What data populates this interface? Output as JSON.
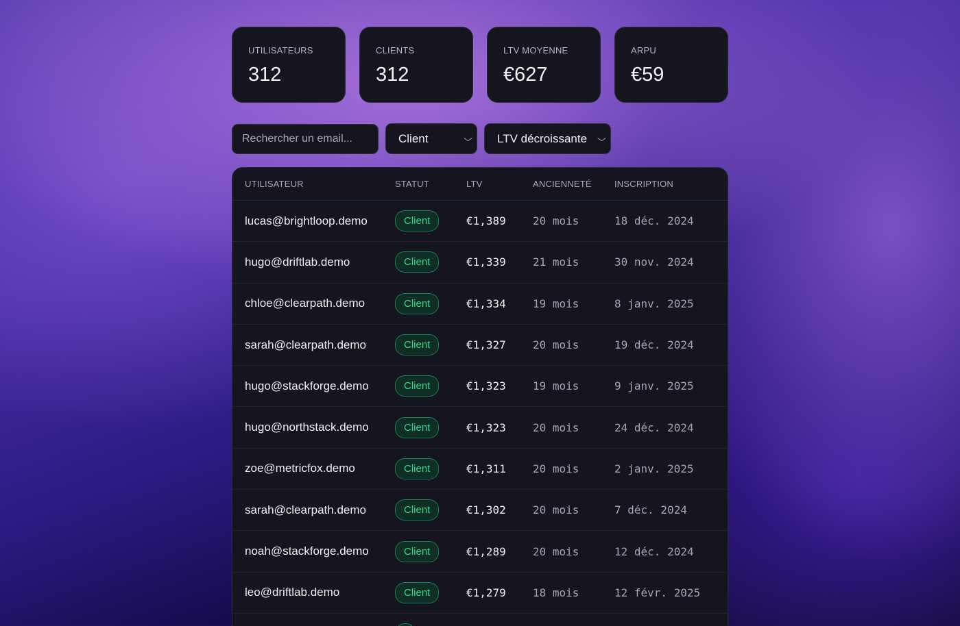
{
  "stats": [
    {
      "label": "UTILISATEURS",
      "value": "312"
    },
    {
      "label": "CLIENTS",
      "value": "312"
    },
    {
      "label": "LTV MOYENNE",
      "value": "€627"
    },
    {
      "label": "ARPU",
      "value": "€59"
    }
  ],
  "filters": {
    "search_placeholder": "Rechercher un email...",
    "status_selected": "Client",
    "sort_selected": "LTV décroissante"
  },
  "table": {
    "headers": {
      "user": "UTILISATEUR",
      "status": "STATUT",
      "ltv": "LTV",
      "age": "ANCIENNETÉ",
      "signup": "INSCRIPTION"
    },
    "rows": [
      {
        "email": "lucas@brightloop.demo",
        "status": "Client",
        "ltv": "€1,389",
        "age": "20 mois",
        "signup": "18 déc. 2024"
      },
      {
        "email": "hugo@driftlab.demo",
        "status": "Client",
        "ltv": "€1,339",
        "age": "21 mois",
        "signup": "30 nov. 2024"
      },
      {
        "email": "chloe@clearpath.demo",
        "status": "Client",
        "ltv": "€1,334",
        "age": "19 mois",
        "signup": "8 janv. 2025"
      },
      {
        "email": "sarah@clearpath.demo",
        "status": "Client",
        "ltv": "€1,327",
        "age": "20 mois",
        "signup": "19 déc. 2024"
      },
      {
        "email": "hugo@stackforge.demo",
        "status": "Client",
        "ltv": "€1,323",
        "age": "19 mois",
        "signup": "9 janv. 2025"
      },
      {
        "email": "hugo@northstack.demo",
        "status": "Client",
        "ltv": "€1,323",
        "age": "20 mois",
        "signup": "24 déc. 2024"
      },
      {
        "email": "zoe@metricfox.demo",
        "status": "Client",
        "ltv": "€1,311",
        "age": "20 mois",
        "signup": "2 janv. 2025"
      },
      {
        "email": "sarah@clearpath.demo",
        "status": "Client",
        "ltv": "€1,302",
        "age": "20 mois",
        "signup": "7 déc. 2024"
      },
      {
        "email": "noah@stackforge.demo",
        "status": "Client",
        "ltv": "€1,289",
        "age": "20 mois",
        "signup": "12 déc. 2024"
      },
      {
        "email": "leo@driftlab.demo",
        "status": "Client",
        "ltv": "€1,279",
        "age": "18 mois",
        "signup": "12 févr. 2025"
      }
    ]
  },
  "colors": {
    "card_bg": "#15151f",
    "badge_text": "#38d98f",
    "badge_border": "#1f7a52"
  },
  "icons": {
    "select_arrow": "chevron-down-icon"
  }
}
